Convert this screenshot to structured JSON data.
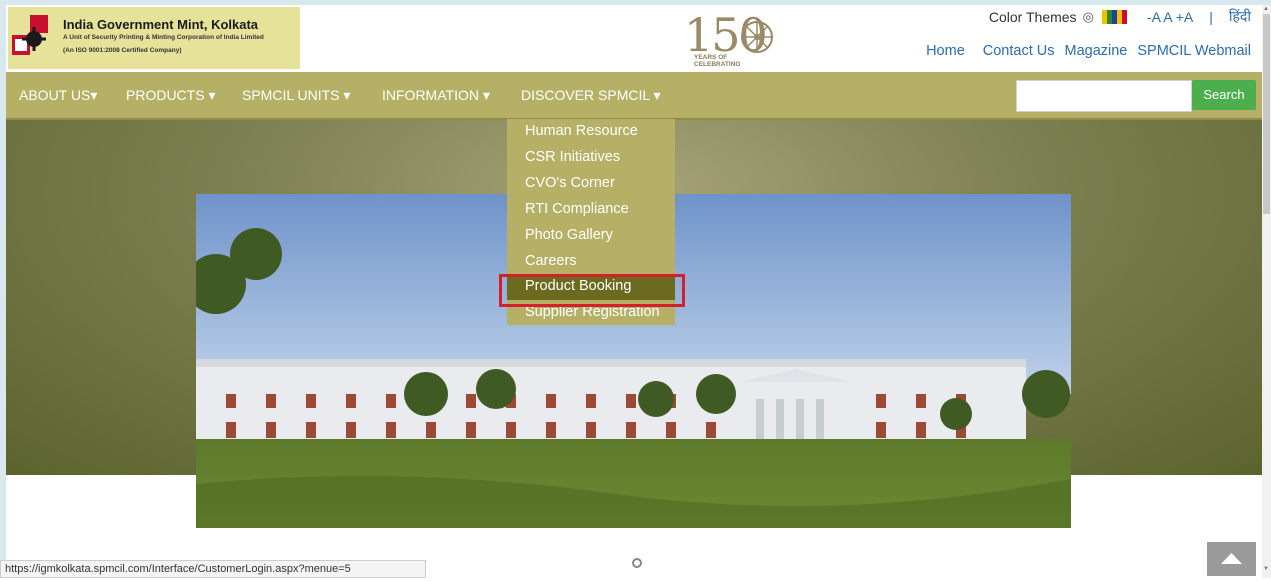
{
  "header": {
    "org_name": "India Government Mint, Kolkata",
    "org_sub1": "A Unit of Security Printing & Minting Corporation of India Limited",
    "org_sub2": "(An ISO 9001:2008 Certified Company)",
    "anniversary_number": "150",
    "anniversary_text_line1": "YEARS OF",
    "anniversary_text_line2": "CELEBRATING",
    "color_themes_label": "Color Themes",
    "font_size_controls": "-A A +A",
    "separator": "|",
    "language_link": "हिंदी",
    "nav_links": [
      "Home",
      "Contact Us",
      "Magazine",
      "SPMCIL Webmail"
    ]
  },
  "theme_colors": [
    "#f2c200",
    "#2b8a1f",
    "#1f3fa8",
    "#f2c200",
    "#c8102e"
  ],
  "menu": {
    "items": [
      "ABOUT US",
      "PRODUCTS",
      "SPMCIL UNITS",
      "INFORMATION",
      "DISCOVER SPMCIL"
    ],
    "search_placeholder": "",
    "search_button": "Search"
  },
  "dropdown": {
    "items": [
      "Human Resource",
      "CSR Initiatives",
      "CVO's Corner",
      "RTI Compliance",
      "Photo Gallery",
      "Careers",
      "Product Booking",
      "Supplier Registration"
    ],
    "active_item": "Product Booking"
  },
  "status_bar": {
    "url": "https://igmkolkata.spmcil.com/Interface/CustomerLogin.aspx?menue=5"
  },
  "colors": {
    "menu_bg": "#b5b065",
    "active_bg": "#6b6a1f",
    "link": "#2a6db0",
    "search_button": "#4cae4c",
    "highlight": "#d4202a"
  }
}
